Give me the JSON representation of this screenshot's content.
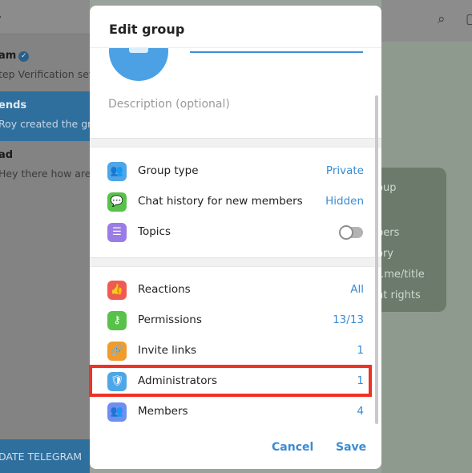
{
  "background": {
    "chats": [
      {
        "title": "am",
        "verified": true,
        "preview": "tep Verification set"
      },
      {
        "title": "ends",
        "verified": false,
        "preview": "Roy created the gro"
      },
      {
        "title": "ad",
        "verified": false,
        "preview": "Hey there how are"
      }
    ],
    "update_button": "DATE TELEGRAM",
    "info_card_lines": [
      "oup",
      "bers",
      "ory",
      "t.me/title",
      "nt rights"
    ]
  },
  "dialog": {
    "title": "Edit group",
    "description_placeholder": "Description (optional)",
    "settings": [
      {
        "label": "Group type",
        "value": "Private",
        "icon": "group-icon",
        "color": "#4ea6e7"
      },
      {
        "label": "Chat history for new members",
        "value": "Hidden",
        "icon": "chat-bubble-icon",
        "color": "#58c14a"
      },
      {
        "label": "Topics",
        "value": "",
        "icon": "topics-icon",
        "color": "#9b7ce6",
        "toggle": false
      }
    ],
    "management": [
      {
        "label": "Reactions",
        "value": "All",
        "icon": "thumbs-up-icon",
        "color": "#ef5b52"
      },
      {
        "label": "Permissions",
        "value": "13/13",
        "icon": "key-icon",
        "color": "#58c14a"
      },
      {
        "label": "Invite links",
        "value": "1",
        "icon": "link-icon",
        "color": "#f29b2d"
      },
      {
        "label": "Administrators",
        "value": "1",
        "icon": "shield-icon",
        "color": "#4ea6e7"
      },
      {
        "label": "Members",
        "value": "4",
        "icon": "members-icon",
        "color": "#6f8ff0"
      }
    ],
    "cancel_label": "Cancel",
    "save_label": "Save"
  },
  "colors": {
    "accent": "#3a8bd2",
    "highlight": "#ee3224"
  }
}
